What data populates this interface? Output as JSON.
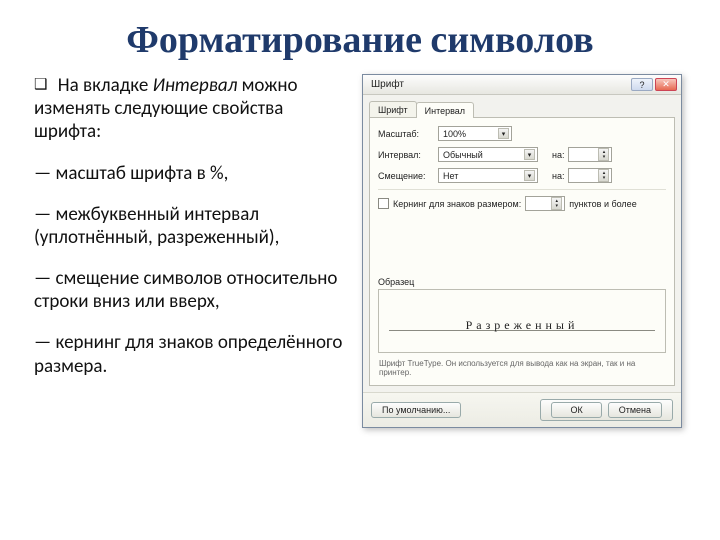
{
  "title": "Форматирование символов",
  "left": {
    "intro_pre": "На вкладке ",
    "intro_em": "Интервал",
    "intro_post": " можно изменять следующие свойства шрифта:",
    "b1": "— масштаб шрифта в %,",
    "b2": "— межбуквенный интервал (уплотнённый, разреженный),",
    "b3": "— смещение символов относительно строки вниз или вверх,",
    "b4": "— кернинг  для знаков определённого размера."
  },
  "dialog": {
    "title": "Шрифт",
    "window_buttons": {
      "help": "?",
      "close": "✕"
    },
    "tabs": {
      "font": "Шрифт",
      "interval": "Интервал"
    },
    "labels": {
      "scale": "Масштаб:",
      "interval": "Интервал:",
      "shift": "Смещение:",
      "na1": "на:",
      "na2": "на:",
      "kerning": "Кернинг для знаков размером:",
      "points_more": "пунктов и более",
      "sample": "Образец",
      "hint": "Шрифт TrueType. Он используется для вывода как на экран, так и на принтер."
    },
    "values": {
      "scale": "100%",
      "interval": "Обычный",
      "shift": "Нет",
      "na1": "",
      "na2": "",
      "kern_pt": ""
    },
    "sample_text": "Разреженный",
    "buttons": {
      "default": "По умолчанию...",
      "ok": "ОК",
      "cancel": "Отмена"
    }
  }
}
